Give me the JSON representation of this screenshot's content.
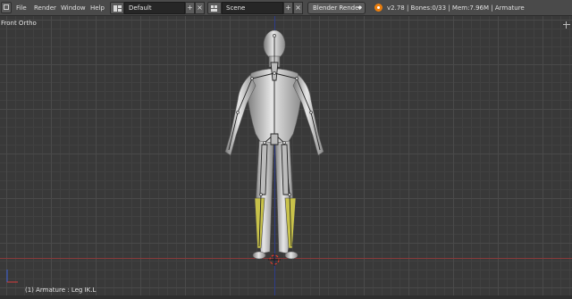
{
  "header": {
    "menu": [
      "File",
      "Render",
      "Window",
      "Help"
    ],
    "screen_layout": "Default",
    "scene": "Scene",
    "render_engine": "Blender Render",
    "status_info": "v2.78 | Bones:0/33 | Mem:7.96M | Armature"
  },
  "viewport": {
    "view_name": "Front Ortho",
    "active_object": "(1) Armature : Leg IK.L"
  },
  "colors": {
    "background": "#393939",
    "header": "#4a4a4a",
    "selected_bone": "#c8c24a",
    "x_axis": "#8a3a3a",
    "z_axis": "#2d3c8a"
  }
}
